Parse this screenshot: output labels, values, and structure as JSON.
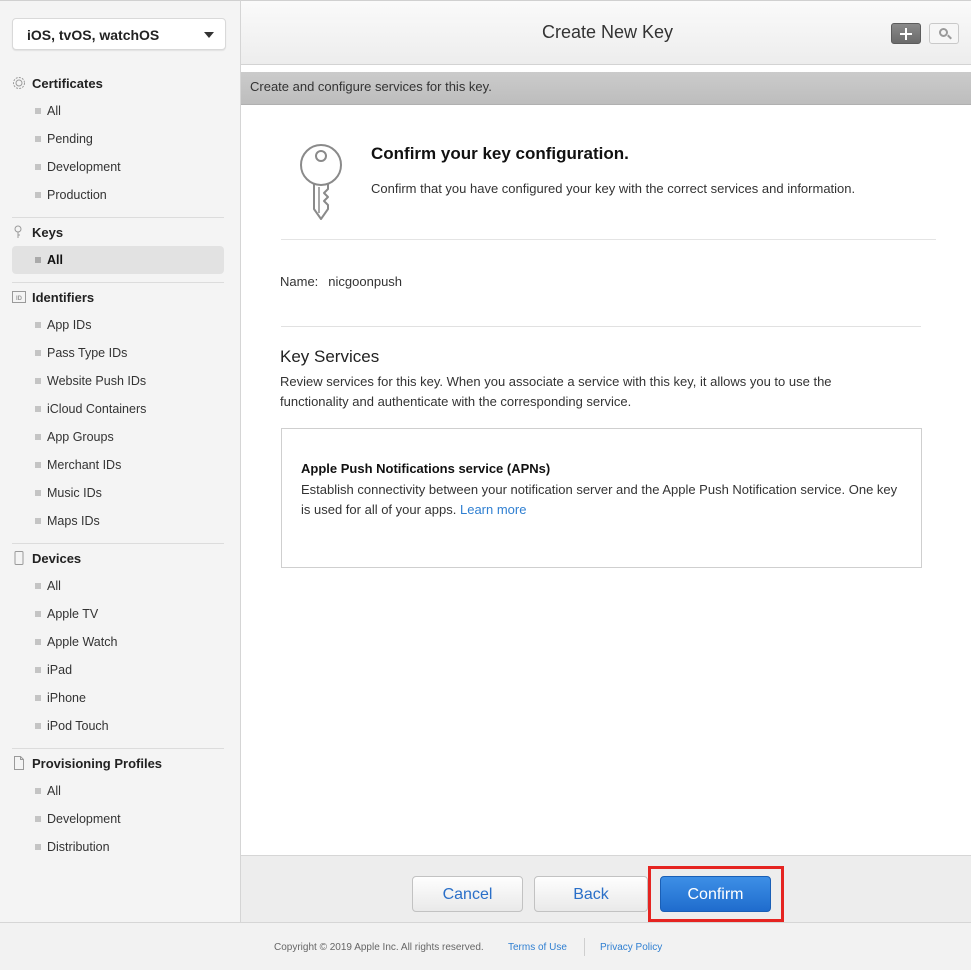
{
  "sidebar": {
    "platform": "iOS, tvOS, watchOS",
    "sections": {
      "certificates": {
        "title": "Certificates",
        "items": [
          "All",
          "Pending",
          "Development",
          "Production"
        ]
      },
      "keys": {
        "title": "Keys",
        "items": [
          "All"
        ]
      },
      "identifiers": {
        "title": "Identifiers",
        "items": [
          "App IDs",
          "Pass Type IDs",
          "Website Push IDs",
          "iCloud Containers",
          "App Groups",
          "Merchant IDs",
          "Music IDs",
          "Maps IDs"
        ]
      },
      "devices": {
        "title": "Devices",
        "items": [
          "All",
          "Apple TV",
          "Apple Watch",
          "iPad",
          "iPhone",
          "iPod Touch"
        ]
      },
      "profiles": {
        "title": "Provisioning Profiles",
        "items": [
          "All",
          "Development",
          "Distribution"
        ]
      }
    },
    "active_item": "keys-all"
  },
  "header": {
    "title": "Create New Key",
    "subtitle": "Create and configure services for this key."
  },
  "confirm": {
    "title": "Confirm your key configuration.",
    "description": "Confirm that you have configured your key with the correct services and information."
  },
  "key": {
    "name_label": "Name:",
    "name_value": "nicgoonpush"
  },
  "services": {
    "title": "Key Services",
    "description": "Review services for this key. When you associate a service with this key, it allows you to use the functionality and authenticate with the corresponding service.",
    "apns": {
      "name": "Apple Push Notifications service (APNs)",
      "description": "Establish connectivity between your notification server and the Apple Push Notification service. One key is used for all of your apps.",
      "link": "Learn more"
    }
  },
  "buttons": {
    "cancel": "Cancel",
    "back": "Back",
    "confirm": "Confirm"
  },
  "footer": {
    "copyright": "Copyright © 2019 Apple Inc. All rights reserved.",
    "terms": "Terms of Use",
    "privacy": "Privacy Policy"
  },
  "colors": {
    "accent": "#2a6fc8",
    "primary_button": "#1f6ccd",
    "highlight": "#e52421"
  }
}
